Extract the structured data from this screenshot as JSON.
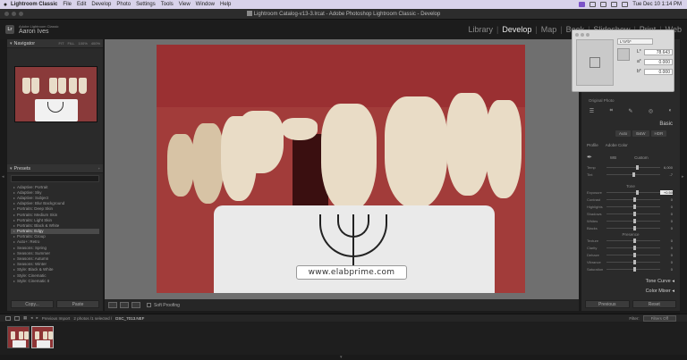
{
  "menubar": {
    "app": "Lightroom Classic",
    "items": [
      "File",
      "Edit",
      "Develop",
      "Photo",
      "Settings",
      "Tools",
      "View",
      "Window",
      "Help"
    ],
    "clock": "Tue Dec 10  1:14 PM"
  },
  "window": {
    "title": "Lightroom Catalog-v13-3.lrcat - Adobe Photoshop Lightroom Classic - Develop"
  },
  "identity": {
    "catalog_small": "Adobe Lightroom Classic",
    "user": "Aaron Ives"
  },
  "modules": {
    "library": "Library",
    "develop": "Develop",
    "map": "Map",
    "book": "Book",
    "slideshow": "Slideshow",
    "print": "Print",
    "web": "Web"
  },
  "navigator": {
    "title": "Navigator",
    "opts": [
      "FIT",
      "FILL",
      "100%",
      "400%"
    ]
  },
  "presets": {
    "title": "Presets",
    "items": [
      "Adaptive: Portrait",
      "Adaptive: Sky",
      "Adaptive: Subject",
      "Adaptive: Blur Background",
      "Portraits: Deep Skin",
      "Portraits: Medium Skin",
      "Portraits: Light Skin",
      "Portraits: Black & White",
      "Portraits: Edgy",
      "Portraits: Group",
      "Auto+: Retro",
      "Seasons: Spring",
      "Seasons: Summer",
      "Seasons: Autumn",
      "Seasons: Winter",
      "Style: Black & White",
      "Style: Cinematic",
      "Style: Cinematic II"
    ],
    "selected_index": 8,
    "copy_label": "Copy...",
    "paste_label": "Paste"
  },
  "photo": {
    "card_text": "www.elabprime.com"
  },
  "toolbar": {
    "soft_proofing": "Soft Proofing"
  },
  "readout": {
    "mode": "L*a*b*",
    "L_label": "L*",
    "L": "78.643",
    "a_label": "a*",
    "a": "0.000",
    "b_label": "b*",
    "b": "0.000"
  },
  "right": {
    "original_photo": "Original Photo",
    "basic": "Basic",
    "treatment": [
      "Auto",
      "B&W",
      "HDR"
    ],
    "profile_label": "Profile",
    "profile_value": "Adobe Color",
    "wb_label": "WB",
    "wb_value": "Custom",
    "sliders": [
      {
        "name": "Temp",
        "value": "6,000",
        "pos": 0.55
      },
      {
        "name": "Tint",
        "value": "-7",
        "pos": 0.48
      }
    ],
    "tone_label": "Tone",
    "tone_sliders": [
      {
        "name": "Exposure",
        "value": "+0.50",
        "pos": 0.55,
        "highlight": true
      },
      {
        "name": "Contrast",
        "value": "0",
        "pos": 0.5
      },
      {
        "name": "Highlights",
        "value": "0",
        "pos": 0.5
      },
      {
        "name": "Shadows",
        "value": "0",
        "pos": 0.5
      },
      {
        "name": "Whites",
        "value": "0",
        "pos": 0.5
      },
      {
        "name": "Blacks",
        "value": "0",
        "pos": 0.5
      }
    ],
    "presence_label": "Presence",
    "presence_sliders": [
      {
        "name": "Texture",
        "value": "0",
        "pos": 0.5
      },
      {
        "name": "Clarity",
        "value": "0",
        "pos": 0.5
      },
      {
        "name": "Dehaze",
        "value": "0",
        "pos": 0.5
      },
      {
        "name": "Vibrance",
        "value": "0",
        "pos": 0.5
      },
      {
        "name": "Saturation",
        "value": "0",
        "pos": 0.5
      }
    ],
    "tone_curve": "Tone Curve",
    "color_mixer": "Color Mixer",
    "previous_label": "Previous",
    "reset_label": "Reset"
  },
  "filmbar": {
    "source": "Previous Import",
    "count": "2 photos /1 selected /",
    "file": "DSC_7013.NEF",
    "filter_label": "Filter:",
    "filter_value": "Filters Off"
  }
}
